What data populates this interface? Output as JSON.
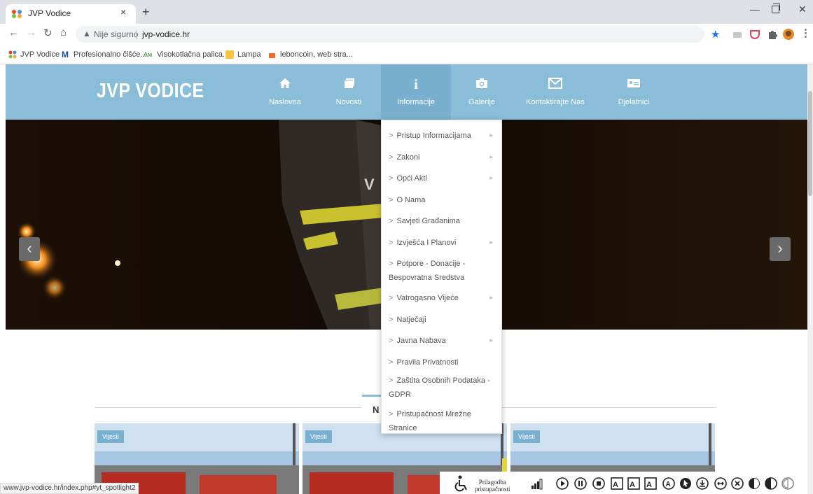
{
  "browser": {
    "tab_title": "JVP Vodice",
    "tab_close": "×",
    "new_tab": "+",
    "security_label": "Nije sigurno",
    "url": "jvp-vodice.hr",
    "bookmarks": [
      {
        "label": "JVP Vodice",
        "icon": "joomla-icon"
      },
      {
        "label": "Profesionalno čišće...",
        "icon": "m-logo-icon"
      },
      {
        "label": "Visokotlačna palica...",
        "icon": "am-logo-icon"
      },
      {
        "label": "Lampa",
        "icon": "folder-icon"
      },
      {
        "label": "leboncoin, web stra...",
        "icon": "leboncoin-icon"
      }
    ],
    "status_url": "www.jvp-vodice.hr/index.php#yt_spotlight2",
    "colors": {
      "tabstrip": "#dee1e6",
      "accent": "#1a73e8"
    }
  },
  "site": {
    "logo": "JVP VODICE",
    "nav": [
      {
        "label": "Naslovna",
        "icon": "home-icon"
      },
      {
        "label": "Novosti",
        "icon": "news-icon"
      },
      {
        "label": "Informacije",
        "icon": "info-icon",
        "active": true
      },
      {
        "label": "Galerije",
        "icon": "camera-icon"
      },
      {
        "label": "Kontaktirajte Nas",
        "icon": "envelope-icon"
      },
      {
        "label": "Djelatnici",
        "icon": "id-card-icon"
      }
    ],
    "dropdown": [
      {
        "label": "Pristup Informacijama",
        "submenu": true
      },
      {
        "label": "Zakoni",
        "submenu": true
      },
      {
        "label": "Opći Akti",
        "submenu": true
      },
      {
        "label": "O Nama",
        "submenu": false
      },
      {
        "label": "Savjeti Građanima",
        "submenu": false
      },
      {
        "label": "Izvješća I Planovi",
        "submenu": true
      },
      {
        "label": "Potpore - Donacije - Bespovratna Sredstva",
        "submenu": false
      },
      {
        "label": "Vatrogasno Vijeće",
        "submenu": true
      },
      {
        "label": "Natječaji",
        "submenu": false
      },
      {
        "label": "Javna Nabava",
        "submenu": true
      },
      {
        "label": "Pravila Privatnosti",
        "submenu": false
      },
      {
        "label": "Zaštita Osobnih Podataka - GDPR",
        "submenu": false
      },
      {
        "label": "Pristupačnost Mrežne Stranice",
        "submenu": false
      }
    ],
    "slider_prev": "‹",
    "slider_next": "›",
    "section_title": "N",
    "cards": [
      {
        "tag": "Vijesti"
      },
      {
        "tag": "Vijesti"
      },
      {
        "tag": "Vijesti"
      }
    ],
    "accessibility": {
      "label_line1": "Prilagodba",
      "label_line2": "pristupačnosti"
    },
    "colors": {
      "navbar": "#8abdd8",
      "nav_active": "#7ab0cf"
    }
  }
}
